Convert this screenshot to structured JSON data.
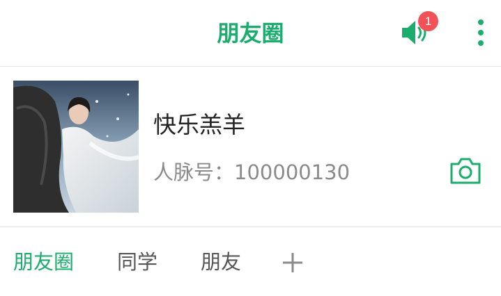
{
  "colors": {
    "accent": "#1aad6e",
    "badge": "#f25157"
  },
  "header": {
    "title": "朋友圈",
    "notification_count": "1",
    "speaker_icon": "speaker-icon",
    "more_icon": "more-vertical-icon"
  },
  "profile": {
    "name": "快乐羔羊",
    "id_label": "人脉号：",
    "id_value": "100000130",
    "camera_icon": "camera-icon"
  },
  "tabs": {
    "items": [
      {
        "label": "朋友圈",
        "active": true
      },
      {
        "label": "同学",
        "active": false
      },
      {
        "label": "朋友",
        "active": false
      }
    ],
    "add_icon": "plus-icon"
  }
}
